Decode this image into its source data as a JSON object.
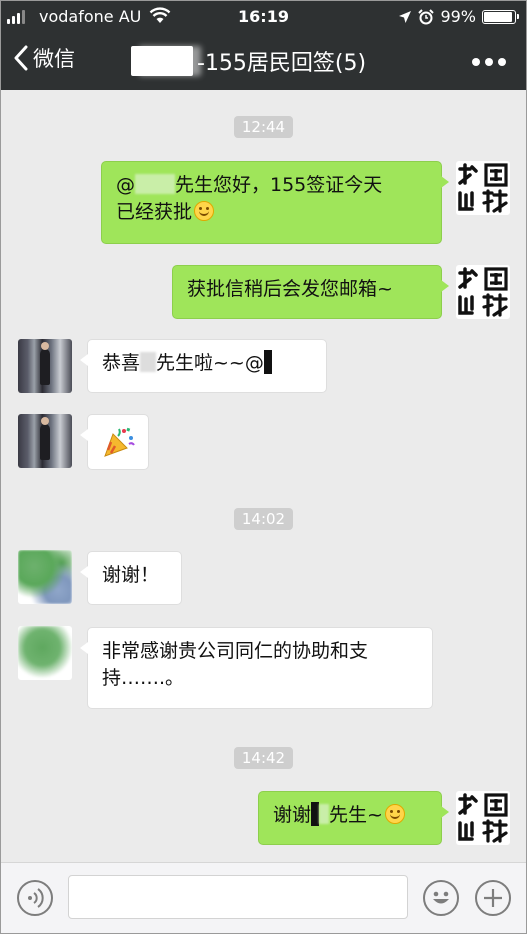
{
  "status_bar": {
    "carrier": "vodafone AU",
    "time": "16:19",
    "battery": "99%",
    "battery_level": 0.99
  },
  "nav": {
    "back_label": "微信",
    "title": "-155居民回签(5)"
  },
  "messages": {
    "ts1": "12:44",
    "m1_pre": "@",
    "m1_mid": "先生您好，155签证今天",
    "m1_line2": "已经获批",
    "m2": "获批信稍后会发您邮箱~",
    "m3_pre": "恭喜",
    "m3_post": "先生啦~~@",
    "ts2": "14:02",
    "m5": "谢谢！",
    "m6_line1": "非常感谢贵公司同仁的协助和支",
    "m6_line2": "持…….。",
    "ts3": "14:42",
    "m7_pre": "谢谢",
    "m7_post": "先生~"
  },
  "colors": {
    "out_bubble": "#9fe55a",
    "in_bubble": "#ffffff",
    "nav_bg": "#2e3132",
    "chat_bg": "#ebebeb"
  },
  "icons": [
    "back-chevron-icon",
    "more-dots-icon",
    "voice-icon",
    "emoji-icon",
    "plus-icon",
    "party-popper-icon",
    "smile-emoji-icon"
  ]
}
